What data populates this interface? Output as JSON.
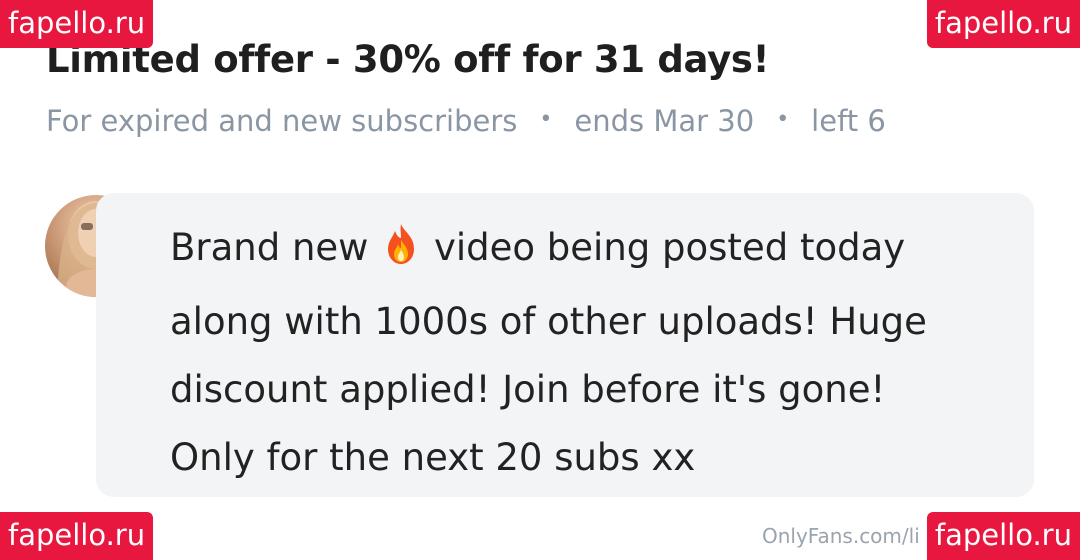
{
  "offer": {
    "title": "Limited offer - 30% off for 31 days!",
    "audience": "For expired and new subscribers",
    "ends": "ends Mar 30",
    "left": "left 6",
    "separator": "•"
  },
  "message": {
    "line1_before": "Brand new",
    "line1_emoji_icon": "fire-icon",
    "line1_after": "video being posted today",
    "line2": "along with 1000s of other uploads! Huge",
    "line3": "discount applied! Join before it's gone!",
    "line4": "Only for the next 20 subs xx"
  },
  "watermarks": {
    "top_left": "fapello.ru",
    "top_right": "fapello.ru",
    "bottom_left": "fapello.ru",
    "bottom_right": "fapello.ru"
  },
  "source_credit": "OnlyFans.com/li",
  "colors": {
    "watermark_bg": "#e8173f",
    "meta_text": "#8a96a3",
    "bubble_bg": "#f2f4f5"
  }
}
